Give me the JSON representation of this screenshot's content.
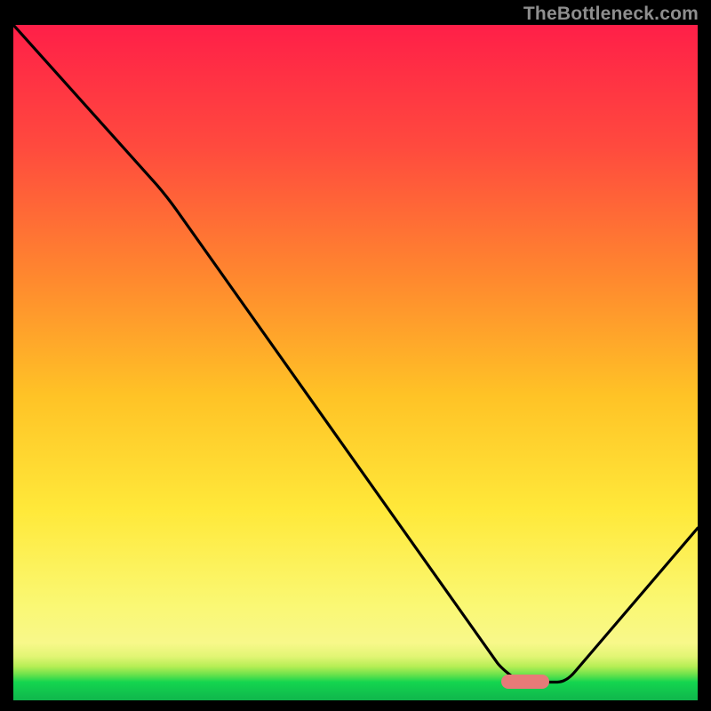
{
  "watermark": "TheBottleneck.com",
  "marker": {
    "color": "#e77a78",
    "x_frac": 0.748,
    "y_frac": 0.972
  },
  "chart_data": {
    "type": "line",
    "title": "",
    "xlabel": "",
    "ylabel": "",
    "xlim": [
      0,
      1
    ],
    "ylim": [
      0,
      1
    ],
    "gradient_bands": [
      {
        "y0": 0.0,
        "y1": 0.027,
        "color": "#14d54f"
      },
      {
        "y0": 0.027,
        "y1": 0.04,
        "color": "#6ae24b"
      },
      {
        "y0": 0.04,
        "y1": 0.055,
        "color": "#b5ee55"
      },
      {
        "y0": 0.055,
        "y1": 0.075,
        "color": "#e6f76a"
      },
      {
        "y0": 0.075,
        "y1": 0.12,
        "color": "#f8f87f"
      },
      {
        "y0": 0.12,
        "y1": 0.5,
        "color": "#ffe93a_to_#ff8a2e"
      },
      {
        "y0": 0.5,
        "y1": 1.0,
        "color": "#ff8a2e_to_#ff1f48"
      }
    ],
    "series": [
      {
        "name": "bottleneck-curve",
        "points": [
          {
            "x": 0.0,
            "y": 1.0
          },
          {
            "x": 0.225,
            "y": 0.745
          },
          {
            "x": 0.715,
            "y": 0.045
          },
          {
            "x": 0.74,
            "y": 0.027
          },
          {
            "x": 0.795,
            "y": 0.027
          },
          {
            "x": 1.0,
            "y": 0.255
          }
        ]
      }
    ]
  }
}
